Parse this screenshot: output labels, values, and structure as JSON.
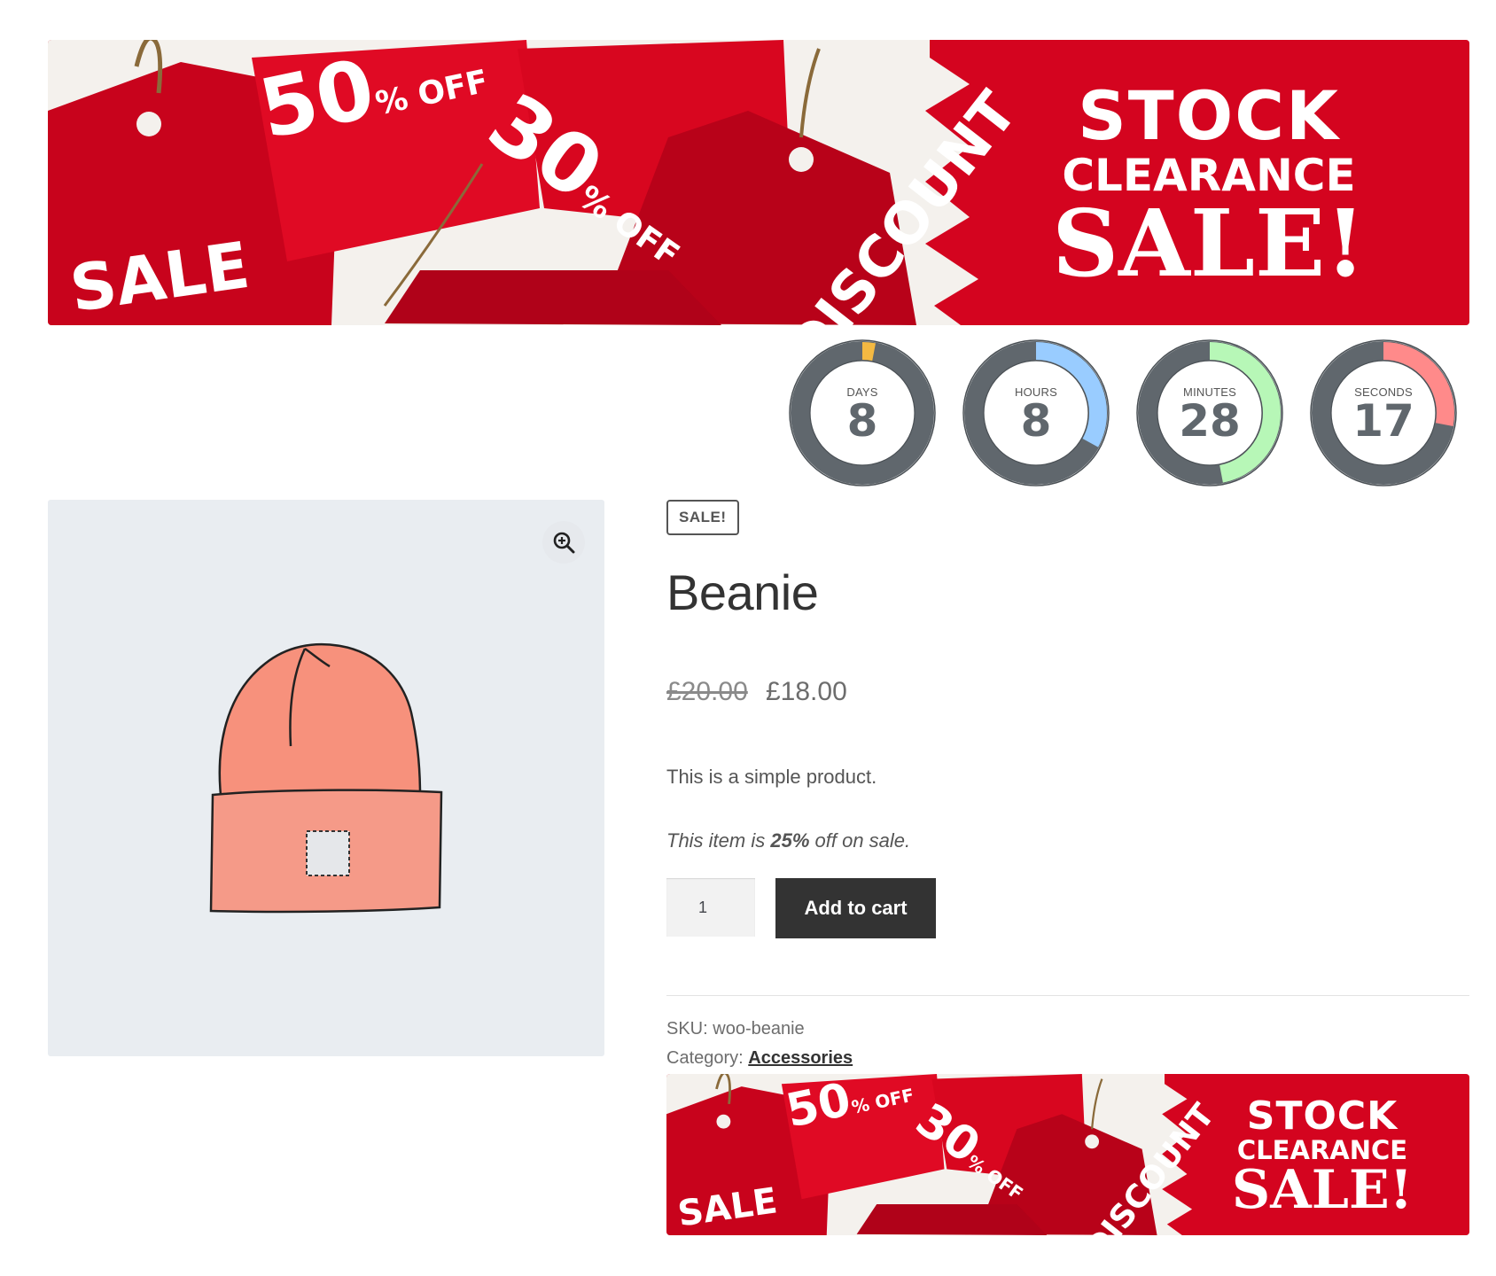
{
  "banner": {
    "headline_line1": "STOCK",
    "headline_line2": "CLEARANCE",
    "headline_line3": "SALE!",
    "tag_50": "50",
    "tag_50_suffix": "% OFF",
    "tag_30": "30",
    "tag_30_suffix": "% OFF",
    "tag_sale": "SALE",
    "tag_discount": "DISCOUNT"
  },
  "countdown": {
    "units": [
      {
        "label": "DAYS",
        "value": "8",
        "color": "#f4b942",
        "fraction": 0.03
      },
      {
        "label": "HOURS",
        "value": "8",
        "color": "#99ccff",
        "fraction": 0.33
      },
      {
        "label": "MINUTES",
        "value": "28",
        "color": "#b7f7b7",
        "fraction": 0.47
      },
      {
        "label": "SECONDS",
        "value": "17",
        "color": "#ff8a8a",
        "fraction": 0.28
      }
    ]
  },
  "product": {
    "badge": "SALE!",
    "title": "Beanie",
    "price_old": "£20.00",
    "price_new": "£18.00",
    "description": "This is a simple product.",
    "sale_note_pre": "This item is ",
    "sale_note_pct": "25%",
    "sale_note_post": " off on sale.",
    "quantity": "1",
    "add_to_cart": "Add to cart",
    "sku_label": "SKU:",
    "sku_value": "woo-beanie",
    "category_label": "Category:",
    "category_value": "Accessories"
  },
  "icons": {
    "zoom": "zoom-in-icon"
  },
  "colors": {
    "banner_red": "#d4041f",
    "button_dark": "#333333",
    "image_bg": "#e9edf1",
    "ring_track": "#60676d"
  }
}
